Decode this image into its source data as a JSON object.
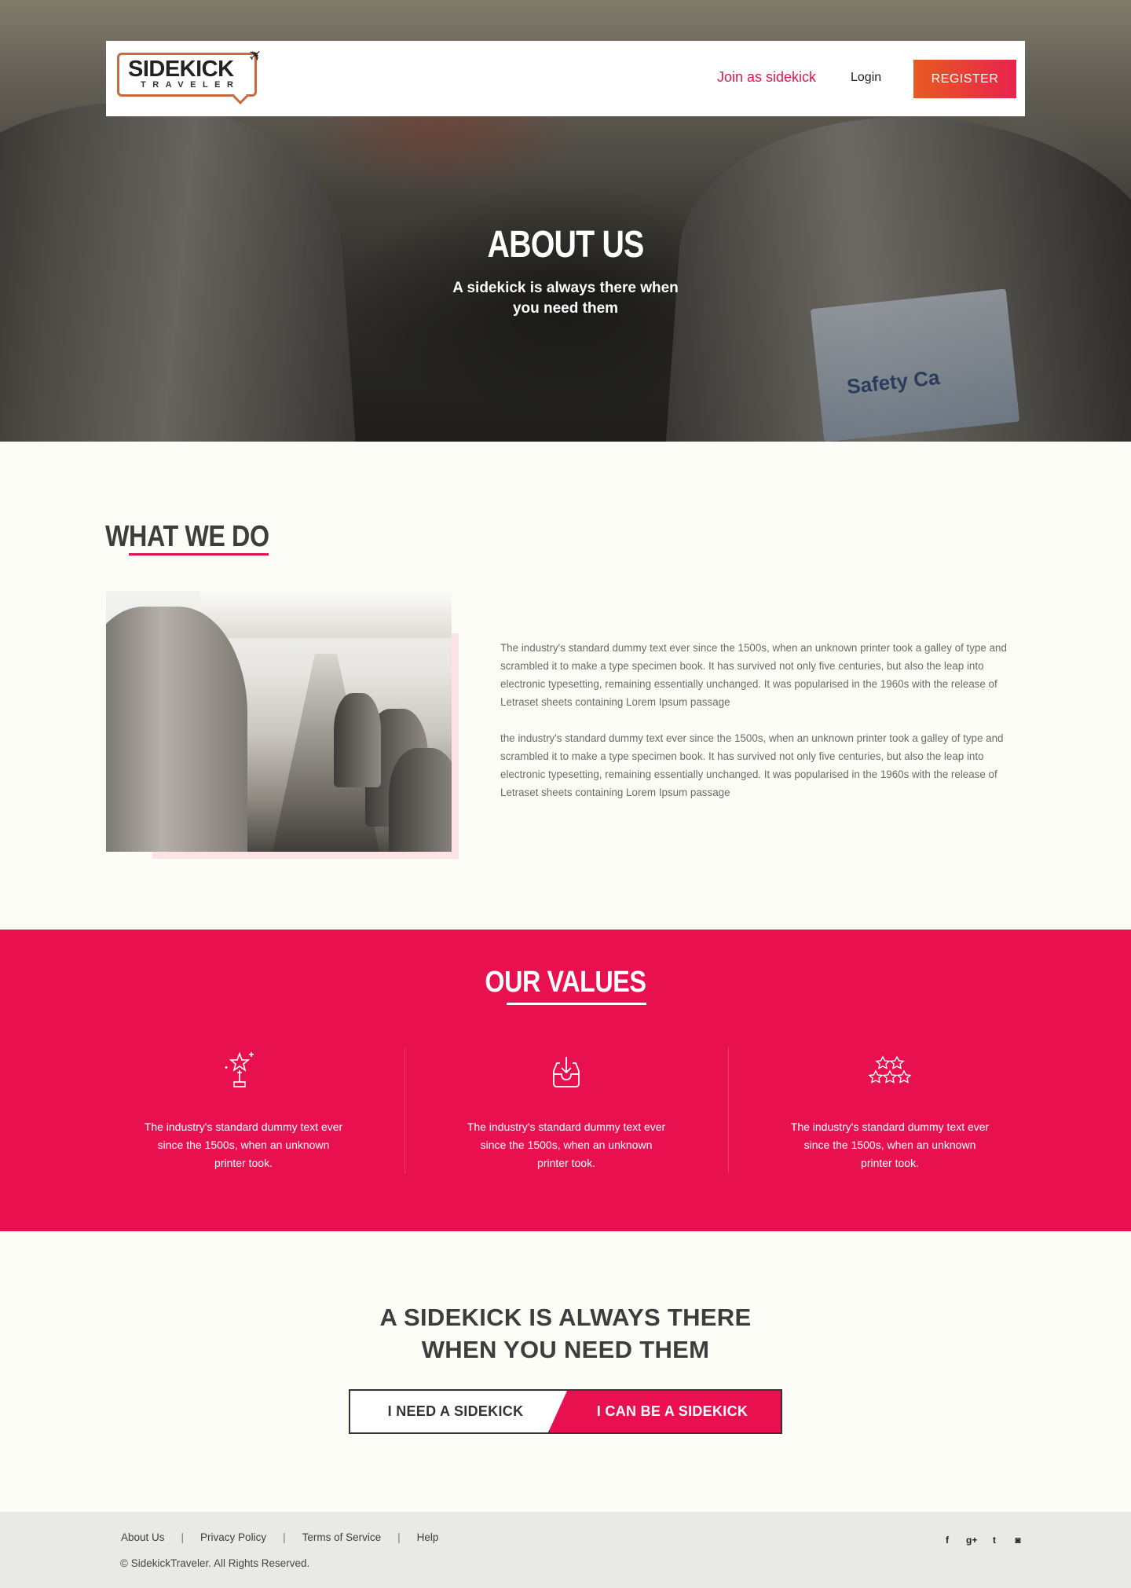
{
  "nav": {
    "logo_word": "SIDEKICK",
    "logo_sub": "TRAVELER",
    "join": "Join as sidekick",
    "login": "Login",
    "register": "REGISTER"
  },
  "hero": {
    "title": "ABOUT US",
    "subtitle": "A sidekick is always there when you need them",
    "card_text": "Safety Ca"
  },
  "what_we_do": {
    "title": "WHAT WE DO",
    "paragraphs": [
      "The industry's standard dummy text ever since the 1500s, when an unknown printer took a galley of type and scrambled it to make a type specimen book. It has survived not only five centuries, but also the leap into electronic typesetting, remaining essentially unchanged. It was popularised in the 1960s with the release of Letraset sheets containing Lorem Ipsum passage",
      "the industry's standard dummy text ever since the 1500s, when an unknown printer took a galley of type and scrambled it to make a type specimen book. It has survived not only five centuries, but also the leap into electronic typesetting, remaining essentially unchanged. It was popularised in the 1960s with the release of Letraset sheets containing Lorem Ipsum passage"
    ]
  },
  "values": {
    "title": "OUR VALUES",
    "items": [
      {
        "icon": "trophy-star-icon",
        "text": "The industry's standard dummy text ever since the 1500s, when an unknown printer took."
      },
      {
        "icon": "inbox-download-icon",
        "text": "The industry's standard dummy text ever since the 1500s, when an unknown printer took."
      },
      {
        "icon": "three-stars-icon",
        "text": "The industry's standard dummy text ever since the 1500s, when an unknown printer took."
      }
    ]
  },
  "cta": {
    "title_line1": "A SIDEKICK IS ALWAYS THERE",
    "title_line2": "WHEN YOU NEED THEM",
    "need": "I NEED A SIDEKICK",
    "be": "I CAN BE A SIDEKICK"
  },
  "footer": {
    "links": [
      "About Us",
      "Privacy Policy",
      "Terms of Service",
      "Help"
    ],
    "separator": "|",
    "copyright": "© SidekickTraveler. All Rights Reserved.",
    "social": [
      {
        "icon": "facebook-icon",
        "glyph": "f"
      },
      {
        "icon": "google-plus-icon",
        "glyph": "g+"
      },
      {
        "icon": "twitter-icon",
        "glyph": "t"
      },
      {
        "icon": "instagram-icon",
        "glyph": "◙"
      }
    ]
  },
  "colors": {
    "accent": "#e8104f",
    "register_start": "#e85a22",
    "register_end": "#e8234c"
  }
}
